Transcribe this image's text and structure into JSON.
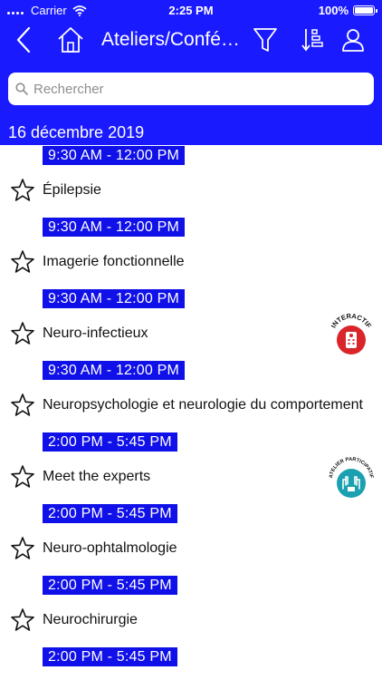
{
  "status_bar": {
    "carrier": "Carrier",
    "time": "2:25 PM",
    "battery": "100%"
  },
  "nav": {
    "title": "Ateliers/Confé…",
    "icons": [
      "back-icon",
      "home-icon",
      "filter-icon",
      "sort-icon",
      "user-icon"
    ]
  },
  "search": {
    "placeholder": "Rechercher",
    "value": ""
  },
  "date_header": "16 décembre 2019",
  "colors": {
    "brand_blue": "#1a1aff",
    "badge_blue": "#1010e8",
    "interactif_red": "#d9262b",
    "participatif_teal": "#1aa0b0"
  },
  "first_time": "9:30 AM - 12:00 PM",
  "sessions": [
    {
      "title": "Épilepsie",
      "time": "9:30 AM - 12:00 PM",
      "badge": null
    },
    {
      "title": "Imagerie fonctionnelle",
      "time": "9:30 AM - 12:00 PM",
      "badge": null
    },
    {
      "title": "Neuro-infectieux",
      "time": "9:30 AM - 12:00 PM",
      "badge": "INTERACTIF"
    },
    {
      "title": "Neuropsychologie et neurologie du comportement",
      "time": "2:00 PM - 5:45 PM",
      "badge": null
    },
    {
      "title": "Meet the experts",
      "time": "2:00 PM - 5:45 PM",
      "badge": "ATELIER PARTICIPATIF"
    },
    {
      "title": "Neuro-ophtalmologie",
      "time": "2:00 PM - 5:45 PM",
      "badge": null
    },
    {
      "title": "Neurochirurgie",
      "time": "2:00 PM - 5:45 PM",
      "badge": null
    }
  ]
}
